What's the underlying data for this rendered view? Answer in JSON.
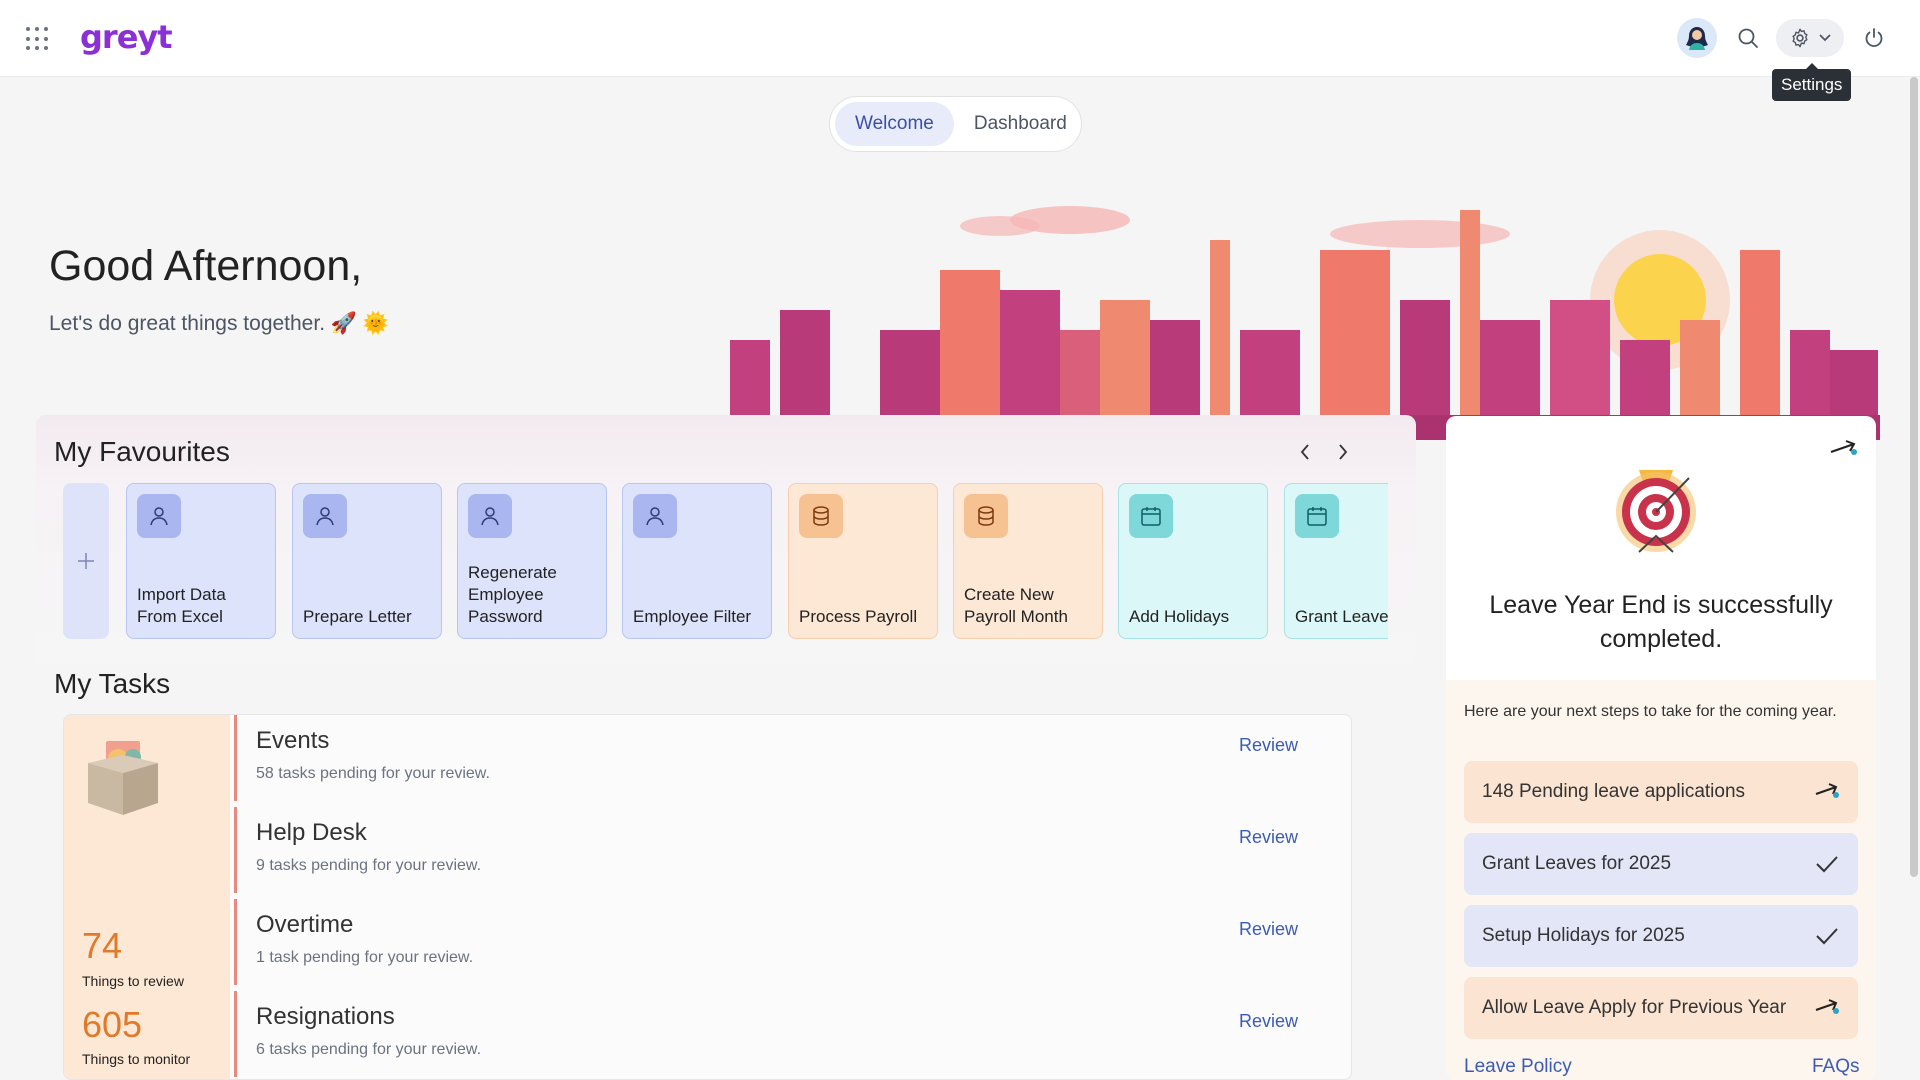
{
  "header": {
    "logo": "greyt",
    "tooltip": "Settings"
  },
  "view_toggle": {
    "tabs": [
      "Welcome",
      "Dashboard"
    ],
    "active": "Welcome"
  },
  "greeting": {
    "title": "Good Afternoon,",
    "subtitle": "Let's do great things together. 🚀 🌞"
  },
  "favourites": {
    "title": "My Favourites",
    "items": [
      {
        "label": "Import Data From Excel",
        "icon": "user-icon",
        "color": "blue"
      },
      {
        "label": "Prepare Letter",
        "icon": "user-icon",
        "color": "blue"
      },
      {
        "label": "Regenerate Employee Password",
        "icon": "user-icon",
        "color": "blue"
      },
      {
        "label": "Employee Filter",
        "icon": "user-icon",
        "color": "blue"
      },
      {
        "label": "Process Payroll",
        "icon": "database-icon",
        "color": "peach"
      },
      {
        "label": "Create New Payroll Month",
        "icon": "database-icon",
        "color": "peach"
      },
      {
        "label": "Add Holidays",
        "icon": "calendar-icon",
        "color": "cyan"
      },
      {
        "label": "Grant Leave",
        "icon": "calendar-icon",
        "color": "cyan"
      }
    ]
  },
  "tasks": {
    "title": "My Tasks",
    "stats": [
      {
        "value": "74",
        "label": "Things to review"
      },
      {
        "value": "605",
        "label": "Things to monitor"
      }
    ],
    "review_label": "Review",
    "items": [
      {
        "name": "Events",
        "sub": "58 tasks pending for your review."
      },
      {
        "name": "Help Desk",
        "sub": "9 tasks pending for your review."
      },
      {
        "name": "Overtime",
        "sub": "1 task pending for your review."
      },
      {
        "name": "Resignations",
        "sub": "6 tasks pending for your review."
      }
    ]
  },
  "leave_panel": {
    "title": "Leave Year End is successfully completed.",
    "intro": "Here are your next steps to take for the coming year.",
    "steps": [
      {
        "label": "148 Pending leave applications",
        "icon": "arrow-icon",
        "color": "peach"
      },
      {
        "label": "Grant Leaves for 2025",
        "icon": "check-icon",
        "color": "lav"
      },
      {
        "label": "Setup Holidays for 2025",
        "icon": "check-icon",
        "color": "lav"
      },
      {
        "label": "Allow Leave Apply for Previous Year",
        "icon": "arrow-icon",
        "color": "peach"
      }
    ],
    "links": [
      "Leave Policy",
      "FAQs"
    ]
  },
  "colors": {
    "accent": "#3b5bb5",
    "brand": "#8b2fd6",
    "stat": "#e07a2a"
  }
}
